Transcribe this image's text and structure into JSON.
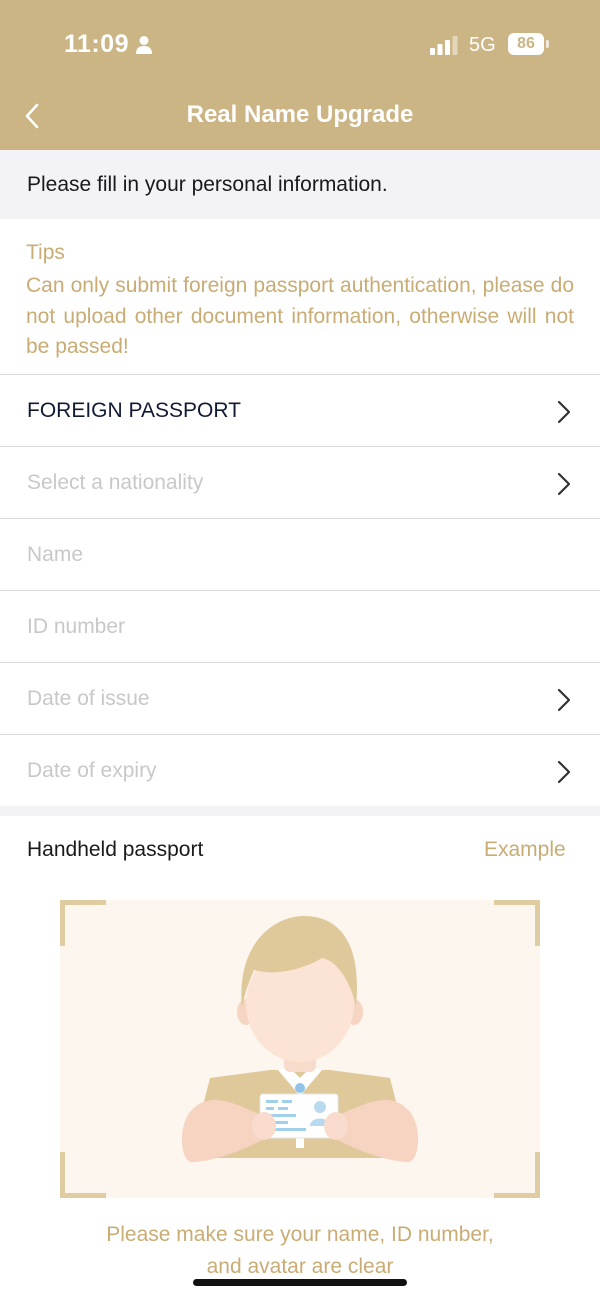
{
  "status_bar": {
    "time": "11:09",
    "network": "5G",
    "battery": "86"
  },
  "nav": {
    "title": "Real Name Upgrade"
  },
  "banner": {
    "text": "Please fill in your personal information."
  },
  "tips": {
    "title": "Tips",
    "body": "Can only submit foreign passport authentication, please do not upload other document information, otherwise will not be passed!"
  },
  "form": {
    "document_type": "FOREIGN PASSPORT",
    "nationality_placeholder": "Select a nationality",
    "name_placeholder": "Name",
    "id_placeholder": "ID number",
    "issue_placeholder": "Date of issue",
    "expiry_placeholder": "Date of expiry"
  },
  "photo": {
    "title": "Handheld passport",
    "example_label": "Example",
    "hint_line1": "Please make sure your name, ID number,",
    "hint_line2": "and avatar are clear"
  },
  "colors": {
    "header": "#ccb584",
    "accent_text": "#c9ac74",
    "banner_bg": "#f3f3f7",
    "upload_bg": "#fdf6ee"
  },
  "icons": [
    "person-icon",
    "signal-icon",
    "battery-icon",
    "back-chevron-icon",
    "chevron-right-icon"
  ]
}
